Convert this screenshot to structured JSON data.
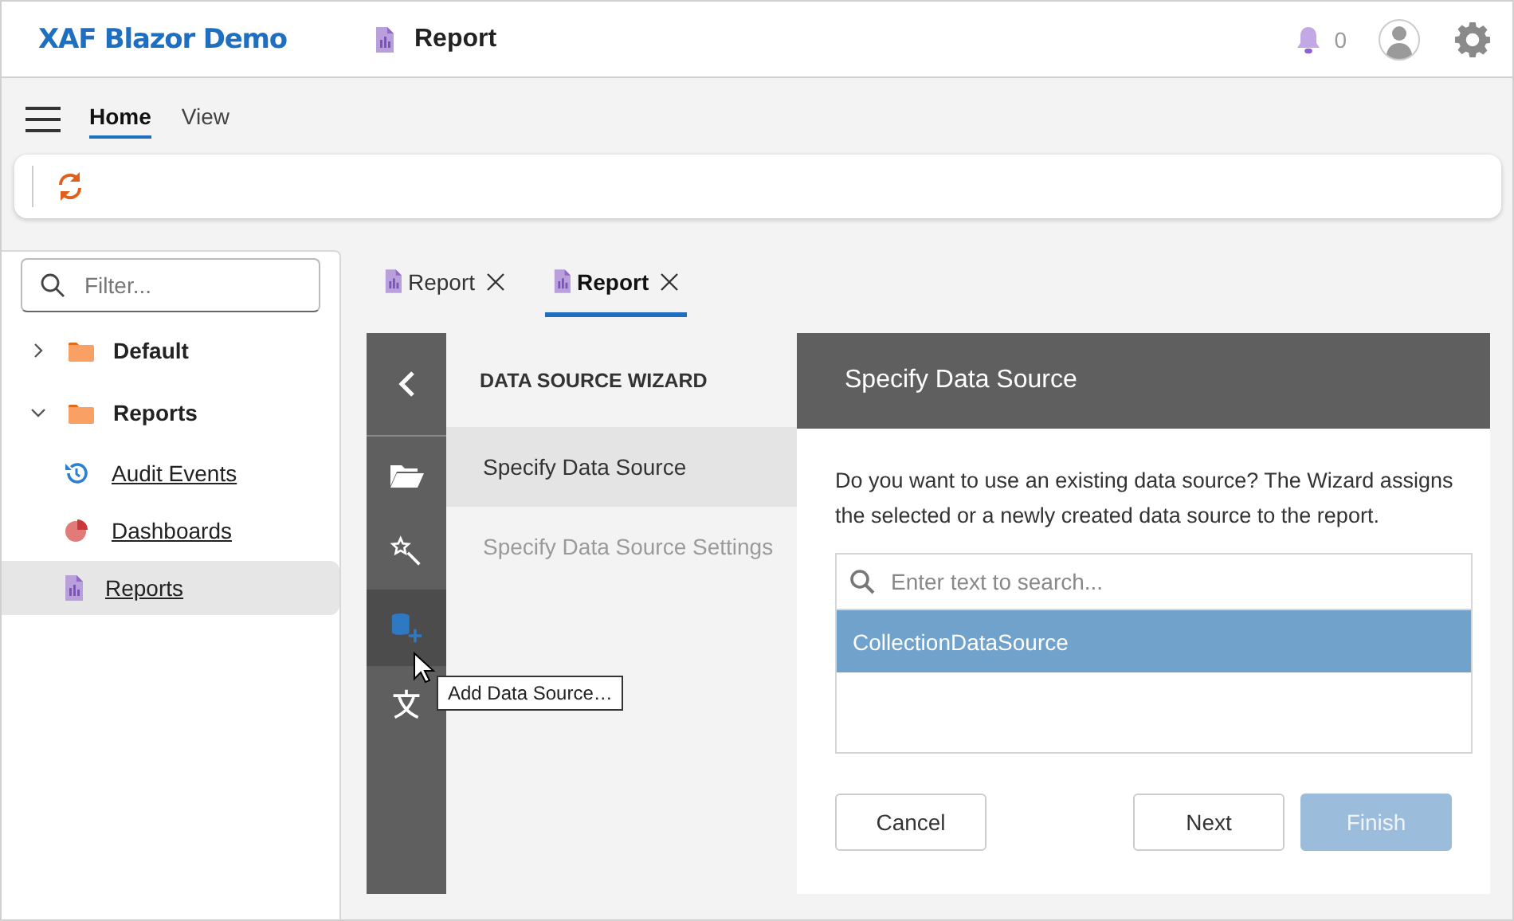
{
  "header": {
    "logo": "XAF Blazor Demo",
    "title": "Report",
    "notifications": "0"
  },
  "ribbon": {
    "tabs": [
      {
        "label": "Home",
        "selected": true
      },
      {
        "label": "View",
        "selected": false
      }
    ]
  },
  "sidebar": {
    "filter_placeholder": "Filter...",
    "items": [
      {
        "label": "Default",
        "kind": "group",
        "expanded": false,
        "selected": false
      },
      {
        "label": "Reports",
        "kind": "group",
        "expanded": true,
        "selected": false,
        "children": [
          {
            "label": "Audit Events",
            "kind": "history",
            "selected": false
          },
          {
            "label": "Dashboards",
            "kind": "dashboard",
            "selected": false
          },
          {
            "label": "Reports",
            "kind": "report",
            "selected": true
          }
        ]
      }
    ]
  },
  "doc_tabs": [
    {
      "label": "Report",
      "selected": false
    },
    {
      "label": "Report",
      "selected": true
    }
  ],
  "wizard": {
    "title": "DATA SOURCE WIZARD",
    "toolbar": [
      {
        "kind": "open",
        "hovered": false
      },
      {
        "kind": "wizard",
        "hovered": false
      },
      {
        "kind": "add-data-source",
        "hovered": true
      },
      {
        "kind": "localize",
        "hovered": false
      }
    ],
    "tooltip": "Add Data Source…",
    "steps": [
      {
        "label": "Specify Data Source",
        "selected": true,
        "disabled": false
      },
      {
        "label": "Specify Data Source Settings",
        "selected": false,
        "disabled": true
      }
    ],
    "page": {
      "title": "Specify Data Source",
      "description": "Do you want to use an existing data source? The Wizard assigns the selected or a newly created data source to the report.",
      "search_placeholder": "Enter text to search...",
      "sources": [
        {
          "label": "CollectionDataSource",
          "selected": true
        }
      ],
      "buttons": [
        {
          "label": "Cancel",
          "kind": "default",
          "disabled": false
        },
        {
          "label": "Next",
          "kind": "default",
          "disabled": false
        },
        {
          "label": "Finish",
          "kind": "primary",
          "disabled": true
        }
      ]
    }
  }
}
